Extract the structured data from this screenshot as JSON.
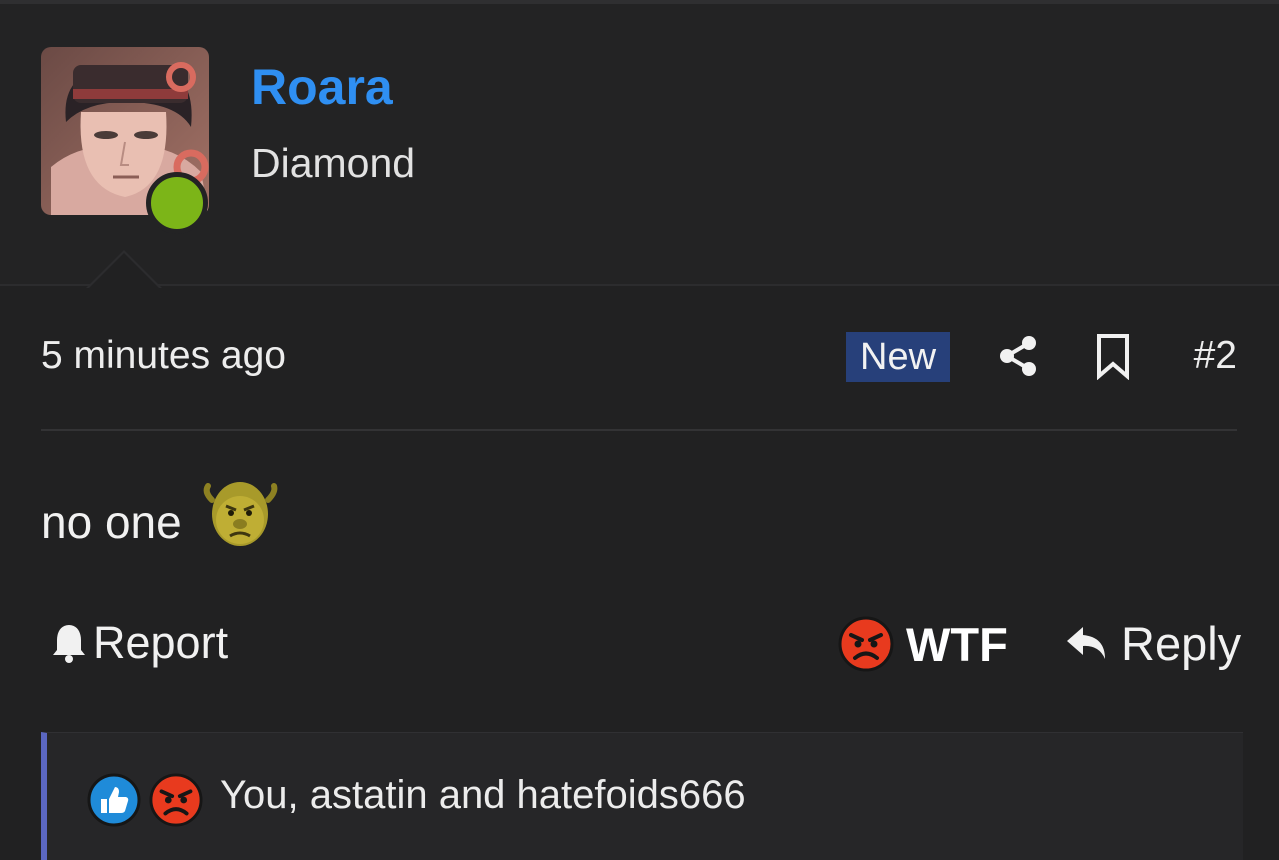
{
  "author": {
    "name": "Roara",
    "title": "Diamond",
    "status": "online",
    "accent_color": "#2f8ff2",
    "online_color": "#7cb518"
  },
  "post": {
    "timestamp": "5 minutes ago",
    "badge": "New",
    "badge_color": "#27407a",
    "number": "#2",
    "body_text": "no one",
    "body_emoji": "shrek-emoji",
    "share_icon": "share-icon",
    "bookmark_icon": "bookmark-icon"
  },
  "actions": {
    "report_label": "Report",
    "report_icon": "bell-icon",
    "reaction_label": "WTF",
    "reaction_icon": "angry-face-icon",
    "reply_label": "Reply",
    "reply_icon": "reply-arrow-icon"
  },
  "reactions": {
    "icons": [
      "like-icon",
      "angry-face-icon"
    ],
    "summary": "You, astatin and hatefoids666",
    "bar_color": "#5b67c2"
  }
}
